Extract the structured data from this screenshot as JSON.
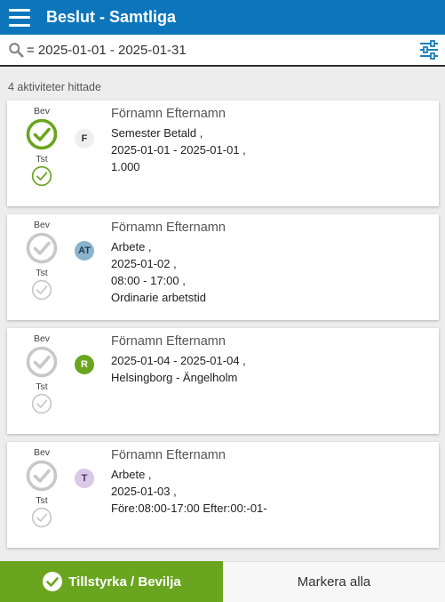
{
  "header": {
    "title": "Beslut - Samtliga",
    "menu_icon": "hamburger-menu-icon"
  },
  "search": {
    "text": "= 2025-01-01 - 2025-01-31",
    "icon": "search-icon",
    "filter_icon": "filter-sliders-icon"
  },
  "count_text": "4 aktiviteter hittade",
  "labels": {
    "bev": "Bev",
    "tst": "Tst"
  },
  "colors": {
    "header": "#0d76bb",
    "approved": "#6aa51f",
    "pending": "#c8c8c8"
  },
  "cards": [
    {
      "name": "Förnamn Efternamn",
      "badge": "F",
      "badge_bg": "#efefef",
      "badge_fg": "#333333",
      "bev_approved": true,
      "tst_approved": true,
      "lines": [
        "Semester Betald ,",
        "2025-01-01 - 2025-01-01 ,",
        "1.000"
      ]
    },
    {
      "name": "Förnamn Efternamn",
      "badge": "AT",
      "badge_bg": "#8ab4cc",
      "badge_fg": "#1e3a56",
      "bev_approved": false,
      "tst_approved": false,
      "lines": [
        "Arbete ,",
        "2025-01-02 ,",
        "08:00 - 17:00 ,",
        "Ordinarie arbetstid"
      ]
    },
    {
      "name": "Förnamn Efternamn",
      "badge": "R",
      "badge_bg": "#6aa51f",
      "badge_fg": "#ffffff",
      "bev_approved": false,
      "tst_approved": false,
      "lines": [
        "2025-01-04 - 2025-01-04 ,",
        "Helsingborg - Ängelholm"
      ]
    },
    {
      "name": "Förnamn Efternamn",
      "badge": "T",
      "badge_bg": "#d9c8e6",
      "badge_fg": "#4a3560",
      "bev_approved": false,
      "tst_approved": false,
      "lines": [
        "Arbete ,",
        "2025-01-03 ,",
        "Före:08:00-17:00 Efter:00:-01-"
      ]
    }
  ],
  "footer": {
    "approve_label": "Tillstyrka / Bevilja",
    "mark_all_label": "Markera alla"
  }
}
